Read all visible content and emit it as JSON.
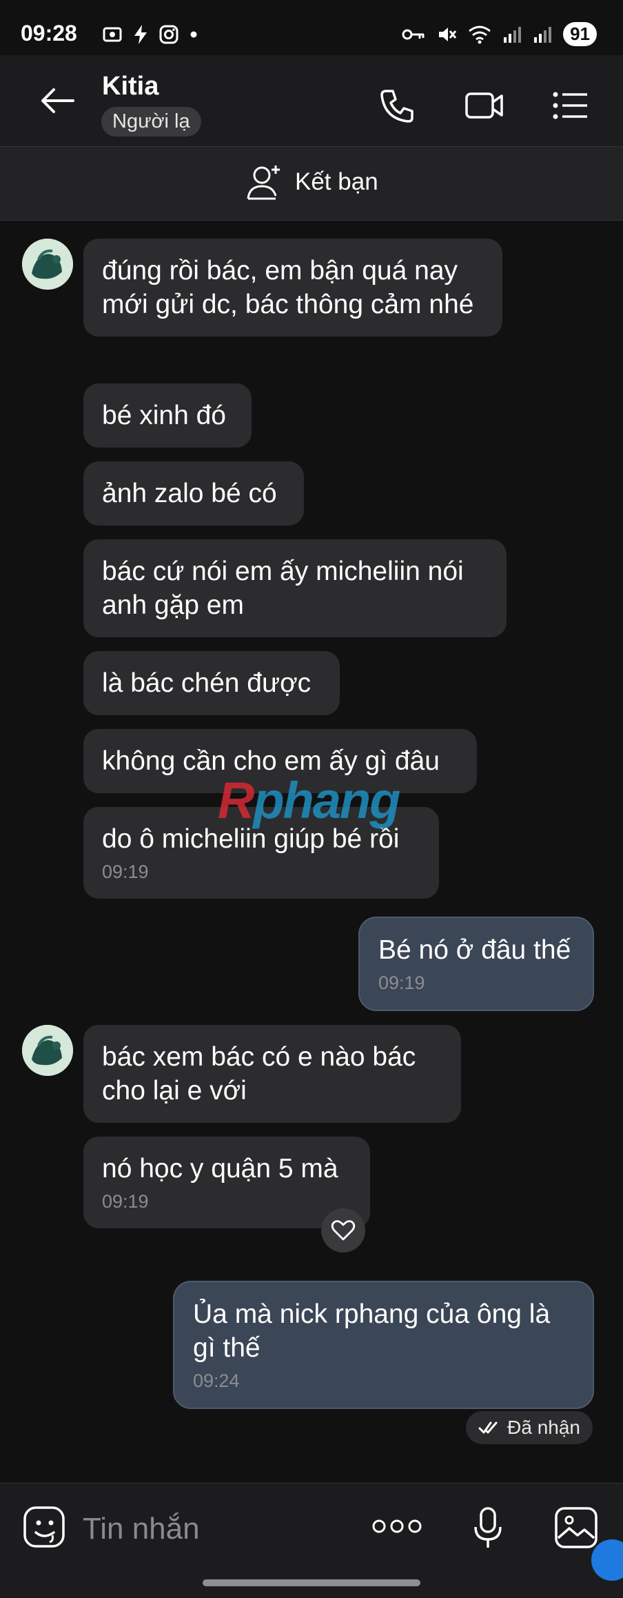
{
  "status_bar": {
    "time": "09:28",
    "battery": "91"
  },
  "header": {
    "contact_name": "Kitia",
    "badge": "Người lạ",
    "call_icon": "phone-icon",
    "video_icon": "video-icon",
    "menu_icon": "menu-icon"
  },
  "friend_bar": {
    "label": "Kết bạn"
  },
  "messages": [
    {
      "text": "đúng rồi bác, em bận quá nay mới gửi dc, bác thông cảm nhé"
    },
    {
      "text": "bé xinh đó"
    },
    {
      "text": "ảnh zalo bé có"
    },
    {
      "text": "bác cứ nói em ấy micheliin nói anh gặp em"
    },
    {
      "text": "là bác chén được"
    },
    {
      "text": "không cần cho em ấy gì đâu"
    },
    {
      "text": "do ô micheliin giúp bé rồi",
      "time": "09:19"
    },
    {
      "text": "Bé nó ở đâu thế",
      "time": "09:19"
    },
    {
      "text": "bác xem bác có e nào bác cho lại e với"
    },
    {
      "text": "nó học y quận 5 mà",
      "time": "09:19"
    },
    {
      "text": "Ủa mà nick rphang của ông là gì thế",
      "time": "09:24"
    }
  ],
  "status_received": "Đã nhận",
  "watermark": {
    "first": "R",
    "rest": "phang"
  },
  "input": {
    "placeholder": "Tin nhắn"
  },
  "colors": {
    "background": "#111111",
    "incoming_bubble": "#2c2c2e",
    "outgoing_bubble": "#3b4656",
    "accent": "#1f7ae0"
  }
}
